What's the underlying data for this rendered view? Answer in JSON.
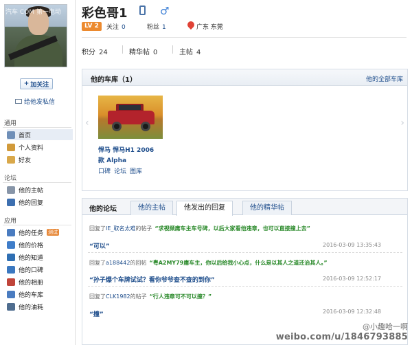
{
  "watermark_top": "汽车   COM 第一电动",
  "profile": {
    "username": "彩色哥1",
    "level": "LV 2",
    "follow_label": "关注",
    "follow_count": "0",
    "fans_label": "粉丝",
    "fans_count": "1",
    "location": "广东 东莞",
    "points_label": "积分",
    "points": "24",
    "elite_label": "精华帖",
    "elite": "0",
    "main_label": "主帖",
    "main": "4"
  },
  "sidebar": {
    "follow_button": "加关注",
    "message_link": "给他发私信",
    "sections": [
      {
        "title": "通用",
        "items": [
          {
            "label": "首页",
            "icon": "home-icon",
            "color": "#6f8fb8"
          },
          {
            "label": "个人资料",
            "icon": "user-icon",
            "color": "#d19a3a"
          },
          {
            "label": "好友",
            "icon": "friends-icon",
            "color": "#d9a84a"
          }
        ]
      },
      {
        "title": "论坛",
        "items": [
          {
            "label": "他的主帖",
            "icon": "post-icon",
            "color": "#8795a8"
          },
          {
            "label": "他的回复",
            "icon": "reply-icon",
            "color": "#3d6fb0"
          }
        ]
      },
      {
        "title": "应用",
        "items": [
          {
            "label": "他的任务",
            "icon": "task-icon",
            "color": "#4a7cc0",
            "badge": "测试"
          },
          {
            "label": "他的价格",
            "icon": "price-icon",
            "color": "#3f7dc9"
          },
          {
            "label": "他的知道",
            "icon": "know-icon",
            "color": "#2f6fb3"
          },
          {
            "label": "他的口碑",
            "icon": "review-icon",
            "color": "#3b78c0"
          },
          {
            "label": "他的相册",
            "icon": "album-icon",
            "color": "#c0443a"
          },
          {
            "label": "他的车库",
            "icon": "garage-icon",
            "color": "#4a7cc0"
          },
          {
            "label": "他的油耗",
            "icon": "fuel-icon",
            "color": "#4f6d8f"
          }
        ]
      }
    ]
  },
  "garage": {
    "title": "他的车库（1）",
    "all_link": "他的全部车库",
    "car_name": "悍马  悍马H1 2006",
    "car_sub": "款 Alpha",
    "links": [
      "口碑",
      "论坛",
      "图库"
    ]
  },
  "forum": {
    "title": "他的论坛",
    "tabs": [
      "他的主帖",
      "他发出的回复",
      "他的精华帖"
    ],
    "active_tab": "他发出的回复",
    "posts": [
      {
        "prefix": "回复了",
        "who": "IE_取名太难",
        "suffix": "的帖子",
        "quote": "“求视频庸车主车号碑，以后大家看他违章，也可以直接撞上去”",
        "reply": "“可以”",
        "time": "2016-03-09 13:35:43"
      },
      {
        "prefix": "回复了",
        "who": "a188442",
        "suffix": "的回帖",
        "quote": "“粤A2MY79庸车主，你以后给我小心点，什么是以其人之道还治其人。”",
        "reply": "“孙子爆个车牌试试？看你爷爷查不查的到你”",
        "time": "2016-03-09 12:52:17"
      },
      {
        "prefix": "回复了",
        "who": "CLK1982",
        "suffix": "的帖子",
        "quote": "“行人违章可不可以撞？”",
        "reply": "“撞”",
        "time": "2016-03-09 12:32:48"
      }
    ]
  },
  "watermark": {
    "line1": "@小趣哈一啊",
    "line2": "weibo.com/u/1846793885"
  }
}
